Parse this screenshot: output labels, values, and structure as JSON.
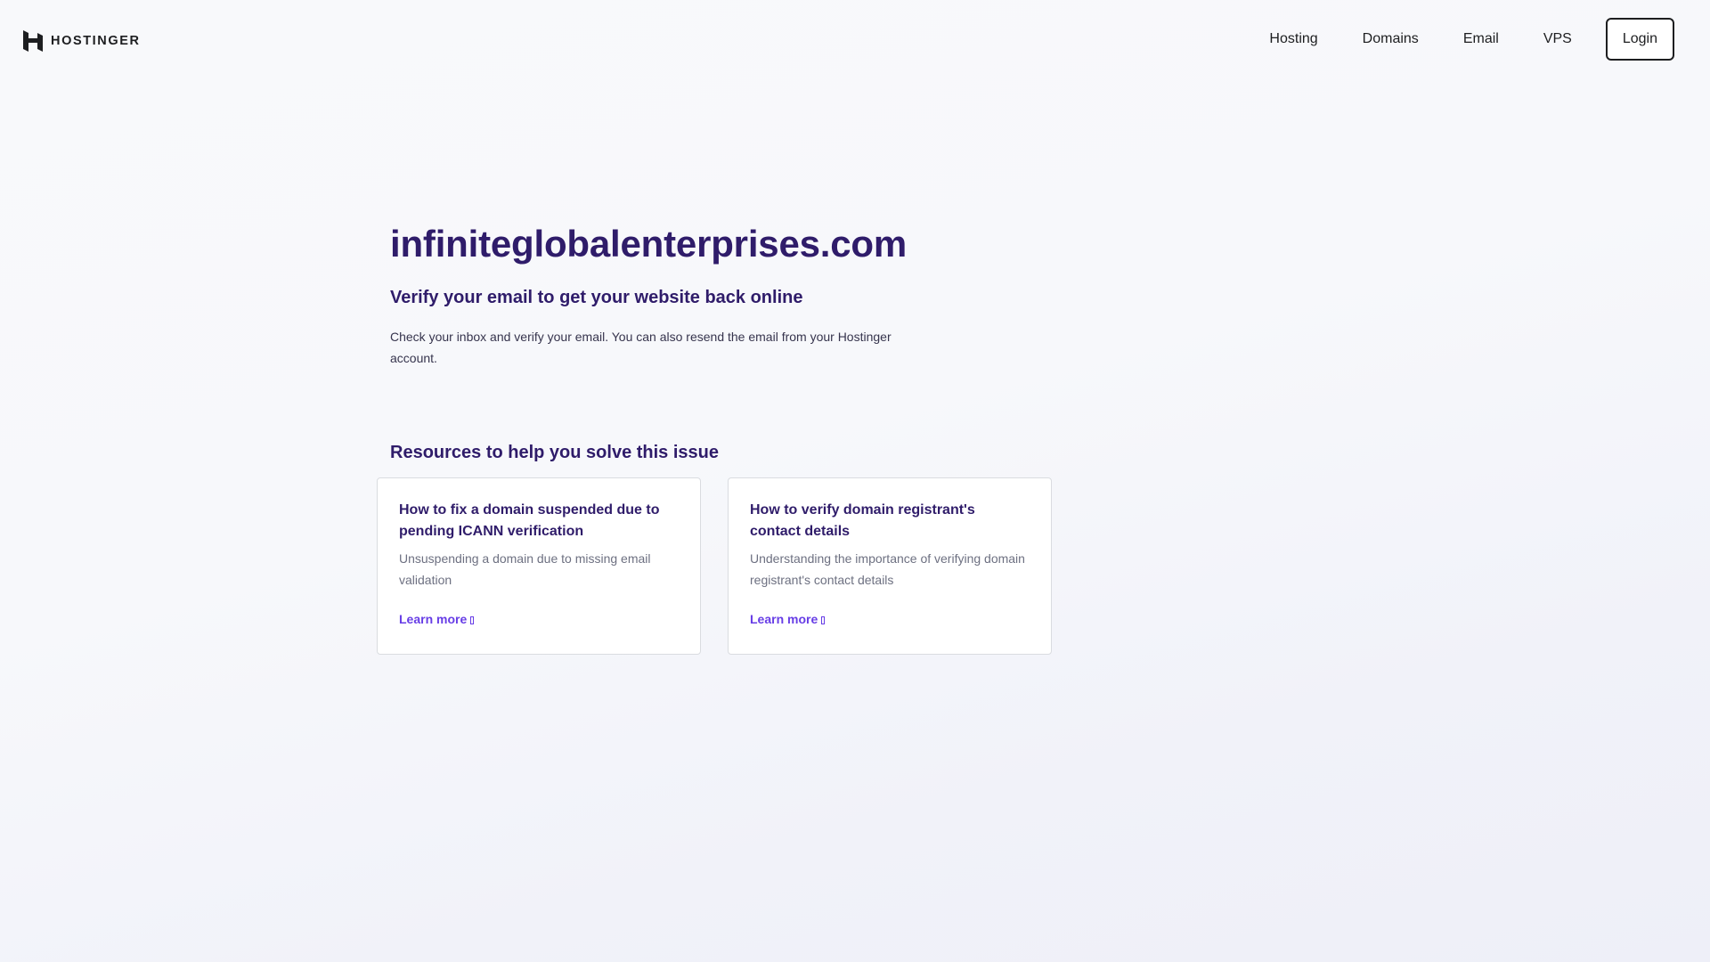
{
  "header": {
    "logo_text": "HOSTINGER",
    "nav": [
      "Hosting",
      "Domains",
      "Email",
      "VPS"
    ],
    "login_label": "Login"
  },
  "main": {
    "domain": "infiniteglobalenterprises.com",
    "subtitle": "Verify your email to get your website back online",
    "description": "Check your inbox and verify your email. You can also resend the email from your Hostinger account.",
    "resources_heading": "Resources to help you solve this issue"
  },
  "cards": [
    {
      "title": "How to fix a domain suspended due to pending ICANN verification",
      "description": "Unsuspending a domain due to missing email validation",
      "link_label": "Learn more"
    },
    {
      "title": "How to verify domain registrant's contact details",
      "description": "Understanding the importance of verifying domain registrant's contact details",
      "link_label": "Learn more"
    }
  ],
  "icons": {
    "logo": "hostinger-logo-icon",
    "link_arrow": "arrow-icon"
  },
  "colors": {
    "brand_purple": "#673de6",
    "heading_navy": "#2f1c6a",
    "text_dark": "#1d1e20",
    "muted_text": "#6d7081"
  }
}
